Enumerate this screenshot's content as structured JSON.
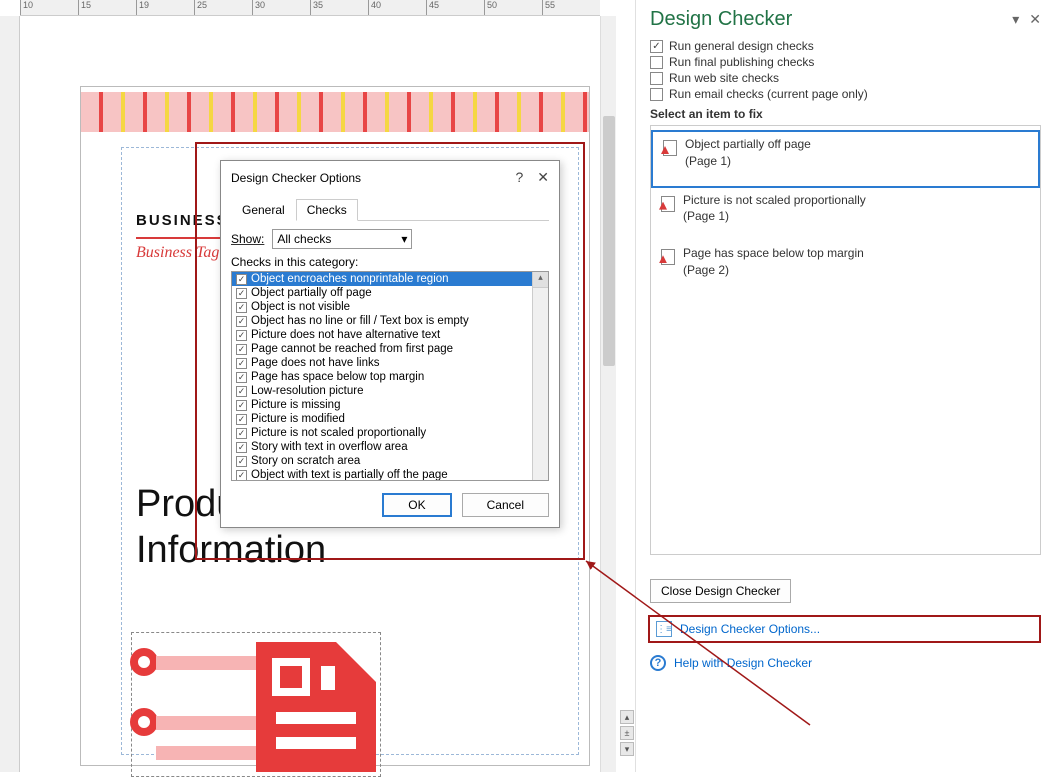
{
  "ruler": [
    "10",
    "15",
    "19",
    "25",
    "30",
    "35",
    "40",
    "45",
    "50",
    "55"
  ],
  "document": {
    "business_name": "BUSINESS",
    "tagline": "Business Tag",
    "product_title_l1": "Produc",
    "product_title_l2": "Information"
  },
  "panel": {
    "title": "Design Checker",
    "checks": [
      {
        "label": "Run general design checks",
        "checked": true
      },
      {
        "label": "Run final publishing checks",
        "checked": false
      },
      {
        "label": "Run web site checks",
        "checked": false
      },
      {
        "label": "Run email checks (current page only)",
        "checked": false
      }
    ],
    "section_label": "Select an item to fix",
    "issues": [
      {
        "title": "Object partially off page",
        "page": "(Page 1)",
        "selected": true
      },
      {
        "title": "Picture is not scaled proportionally",
        "page": "(Page 1)",
        "selected": false
      },
      {
        "title": "Page has space below top margin",
        "page": "(Page 2)",
        "selected": false
      }
    ],
    "close_label": "Close Design Checker",
    "options_link": "Design Checker Options...",
    "help_link": "Help with Design Checker"
  },
  "dialog": {
    "title": "Design Checker Options",
    "tabs": {
      "general": "General",
      "checks": "Checks"
    },
    "show_label": "Show:",
    "show_value": "All checks",
    "category_label": "Checks in this category:",
    "items": [
      "Object encroaches nonprintable region",
      "Object partially off page",
      "Object is not visible",
      "Object has no line or fill / Text box is empty",
      "Picture does not have alternative text",
      "Page cannot be reached from first page",
      "Page does not have links",
      "Page has space below top margin",
      "Low-resolution picture",
      "Picture is missing",
      "Picture is modified",
      "Picture is not scaled proportionally",
      "Story with text in overflow area",
      "Story on scratch area",
      "Object with text is partially off the page"
    ],
    "ok": "OK",
    "cancel": "Cancel"
  }
}
